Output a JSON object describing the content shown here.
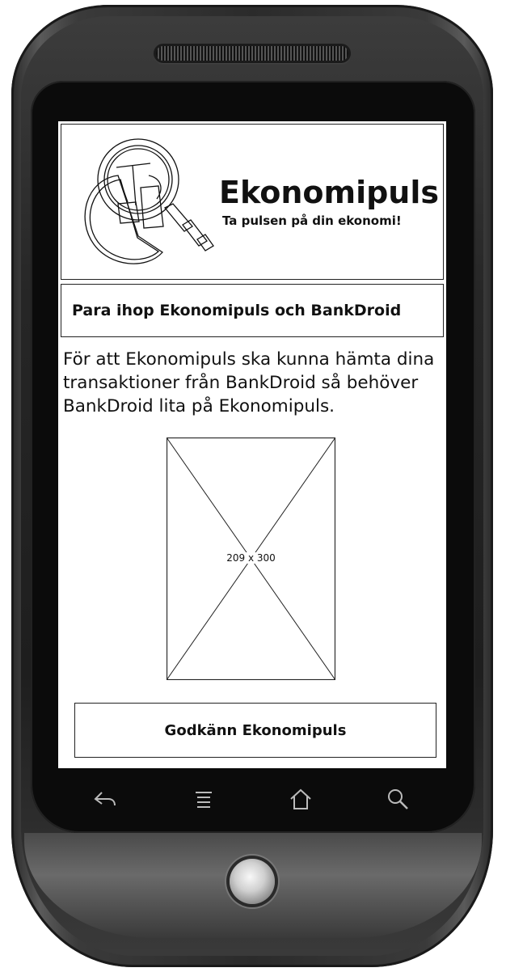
{
  "app": {
    "title": "Ekonomipuls",
    "tagline": "Ta pulsen på din ekonomi!"
  },
  "section": {
    "title": "Para ihop Ekonomipuls och BankDroid"
  },
  "body": {
    "text": "För att Ekonomipuls ska kunna hämta dina transaktioner från BankDroid så behöver BankDroid lita på Ekonomipuls."
  },
  "image_placeholder": {
    "label": "209 x 300"
  },
  "actions": {
    "approve_label": "Godkänn Ekonomipuls"
  },
  "navbar": {
    "icons": [
      "back-icon",
      "menu-icon",
      "home-icon",
      "search-icon"
    ]
  },
  "colors": {
    "ink": "#111111",
    "screen_bg": "#ffffff",
    "phone_body": "#2b2b2b"
  }
}
